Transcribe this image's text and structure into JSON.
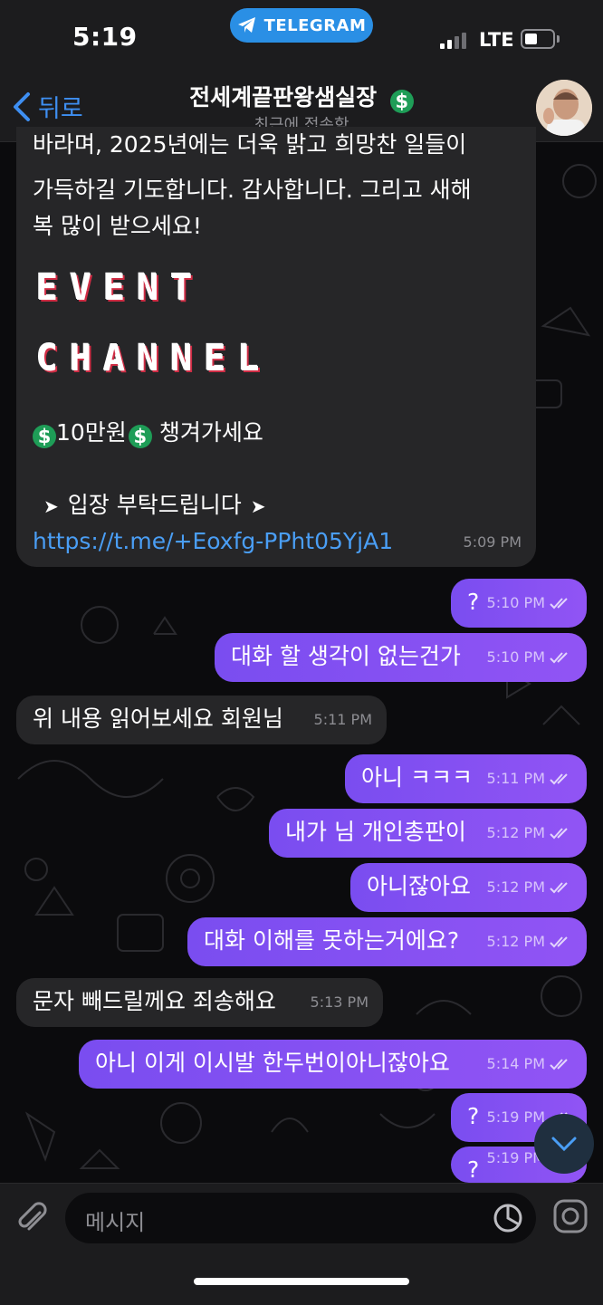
{
  "status_bar": {
    "time": "5:19",
    "app_pill": "TELEGRAM",
    "network": "LTE"
  },
  "header": {
    "back_label": "뒤로",
    "title": "전세계끝판왕샘실장",
    "title_emoji": "💲",
    "subtitle": "최근에 접속함"
  },
  "big_message": {
    "lines": [
      "바라며, 2025년에는 더욱 밝고 희망찬 일들이",
      "가득하길 기도합니다. 감사합니다. 그리고 새해",
      "복 많이 받으세요!"
    ],
    "banner_line1": "EVENT",
    "banner_line2": "CHANNEL",
    "promo_amount": "10만원",
    "promo_text": "챙겨가세요",
    "entry_text": "입장 부탁드립니다",
    "link": "https://t.me/+Eoxfg-PPht05YjA1",
    "time": "5:09 PM"
  },
  "messages": [
    {
      "dir": "out",
      "text": "?",
      "time": "5:10 PM"
    },
    {
      "dir": "out",
      "text": "대화 할 생각이 없는건가",
      "time": "5:10 PM"
    },
    {
      "dir": "in",
      "text": "위 내용 읽어보세요 회원님",
      "time": "5:11 PM"
    },
    {
      "dir": "out",
      "text": "아니 ㅋㅋㅋ",
      "time": "5:11 PM"
    },
    {
      "dir": "out",
      "text": "내가 님 개인총판이",
      "time": "5:12 PM"
    },
    {
      "dir": "out",
      "text": "아니잖아요",
      "time": "5:12 PM"
    },
    {
      "dir": "out",
      "text": "대화 이해를 못하는거에요?",
      "time": "5:12 PM"
    },
    {
      "dir": "in",
      "text": "문자 빼드릴께요 죄송해요",
      "time": "5:13 PM"
    },
    {
      "dir": "out",
      "text": "아니 이게 이시발 한두번이아니잖아요",
      "time": "5:14 PM"
    },
    {
      "dir": "out",
      "text": "?",
      "time": "5:19 PM"
    },
    {
      "dir": "out",
      "text": "?",
      "time": "5:19 PM"
    }
  ],
  "input": {
    "placeholder": "메시지"
  },
  "colors": {
    "outgoing_bubble": "#8a52f2",
    "incoming_bubble": "#262628",
    "link": "#4a9ef5",
    "accent_blue": "#2a8fe5"
  },
  "icons": {
    "attach": "paperclip-icon",
    "sticker": "sticker-icon",
    "camera": "camera-icon",
    "scroll_down": "chevron-down-icon",
    "read_receipt": "double-check-icon"
  }
}
